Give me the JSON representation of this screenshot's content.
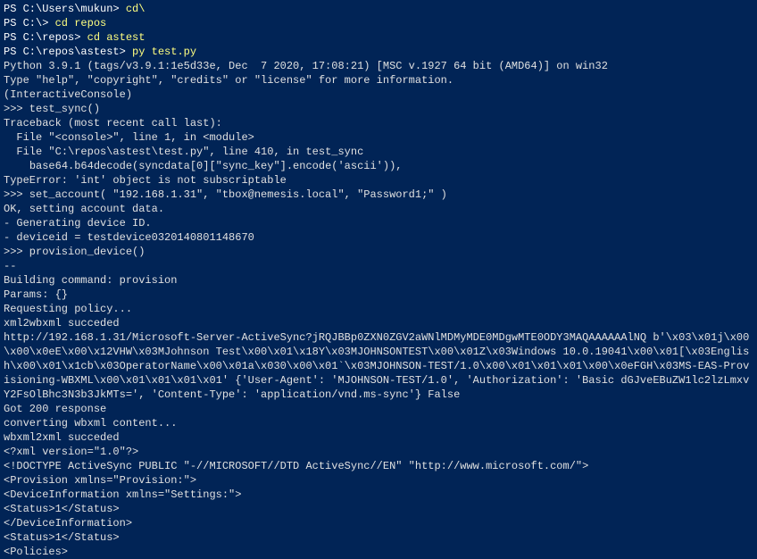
{
  "lines": [
    {
      "type": "prompt-cmd",
      "prompt": "PS C:\\Users\\mukun> ",
      "cmd": "cd\\"
    },
    {
      "type": "prompt-cmd",
      "prompt": "PS C:\\> ",
      "cmd": "cd repos"
    },
    {
      "type": "prompt-cmd",
      "prompt": "PS C:\\repos> ",
      "cmd": "cd astest"
    },
    {
      "type": "prompt-cmd",
      "prompt": "PS C:\\repos\\astest> ",
      "cmd": "py test.py"
    },
    {
      "type": "output",
      "text": "Python 3.9.1 (tags/v3.9.1:1e5d33e, Dec  7 2020, 17:08:21) [MSC v.1927 64 bit (AMD64)] on win32"
    },
    {
      "type": "output",
      "text": "Type \"help\", \"copyright\", \"credits\" or \"license\" for more information."
    },
    {
      "type": "output",
      "text": "(InteractiveConsole)"
    },
    {
      "type": "output",
      "text": ">>> test_sync()"
    },
    {
      "type": "output",
      "text": "Traceback (most recent call last):"
    },
    {
      "type": "output",
      "text": "  File \"<console>\", line 1, in <module>"
    },
    {
      "type": "output",
      "text": "  File \"C:\\repos\\astest\\test.py\", line 410, in test_sync"
    },
    {
      "type": "output",
      "text": "    base64.b64decode(syncdata[0][\"sync_key\"].encode('ascii')),"
    },
    {
      "type": "output",
      "text": "TypeError: 'int' object is not subscriptable"
    },
    {
      "type": "output",
      "text": ">>> set_account( \"192.168.1.31\", \"tbox@nemesis.local\", \"Password1;\" )"
    },
    {
      "type": "output",
      "text": "OK, setting account data."
    },
    {
      "type": "output",
      "text": "- Generating device ID."
    },
    {
      "type": "output",
      "text": "- deviceid = testdevice0320140801148670"
    },
    {
      "type": "output",
      "text": ">>> provision_device()"
    },
    {
      "type": "output",
      "text": "--"
    },
    {
      "type": "output",
      "text": "Building command: provision"
    },
    {
      "type": "output",
      "text": "Params: {}"
    },
    {
      "type": "output",
      "text": "Requesting policy..."
    },
    {
      "type": "output",
      "text": "xml2wbxml succeded"
    },
    {
      "type": "output",
      "text": "http://192.168.1.31/Microsoft-Server-ActiveSync?jRQJBBp0ZXN0ZGV2aWNlMDMyMDE0MDgwMTE0ODY3MAQAAAAAAlNQ b'\\x03\\x01j\\x00\\x00\\x0eE\\x00\\x12VHW\\x03MJohnson Test\\x00\\x01\\x18Y\\x03MJOHNSONTEST\\x00\\x01Z\\x03Windows 10.0.19041\\x00\\x01[\\x03English\\x00\\x01\\x1cb\\x03OperatorName\\x00\\x01a\\x030\\x00\\x01`\\x03MJOHNSON-TEST/1.0\\x00\\x01\\x01\\x01\\x00\\x0eFGH\\x03MS-EAS-Provisioning-WBXML\\x00\\x01\\x01\\x01\\x01' {'User-Agent': 'MJOHNSON-TEST/1.0', 'Authorization': 'Basic dGJveEBuZW1lc2lzLmxvY2FsOlBhc3N3b3JkMTs=', 'Content-Type': 'application/vnd.ms-sync'} False"
    },
    {
      "type": "output",
      "text": "Got 200 response"
    },
    {
      "type": "output",
      "text": "converting wbxml content..."
    },
    {
      "type": "output",
      "text": "wbxml2xml succeded"
    },
    {
      "type": "output",
      "text": "<?xml version=\"1.0\"?>"
    },
    {
      "type": "output",
      "text": "<!DOCTYPE ActiveSync PUBLIC \"-//MICROSOFT//DTD ActiveSync//EN\" \"http://www.microsoft.com/\">"
    },
    {
      "type": "output",
      "text": "<Provision xmlns=\"Provision:\">"
    },
    {
      "type": "output",
      "text": "<DeviceInformation xmlns=\"Settings:\">"
    },
    {
      "type": "output",
      "text": "<Status>1</Status>"
    },
    {
      "type": "output",
      "text": "</DeviceInformation>"
    },
    {
      "type": "output",
      "text": "<Status>1</Status>"
    },
    {
      "type": "output",
      "text": "<Policies>"
    }
  ]
}
